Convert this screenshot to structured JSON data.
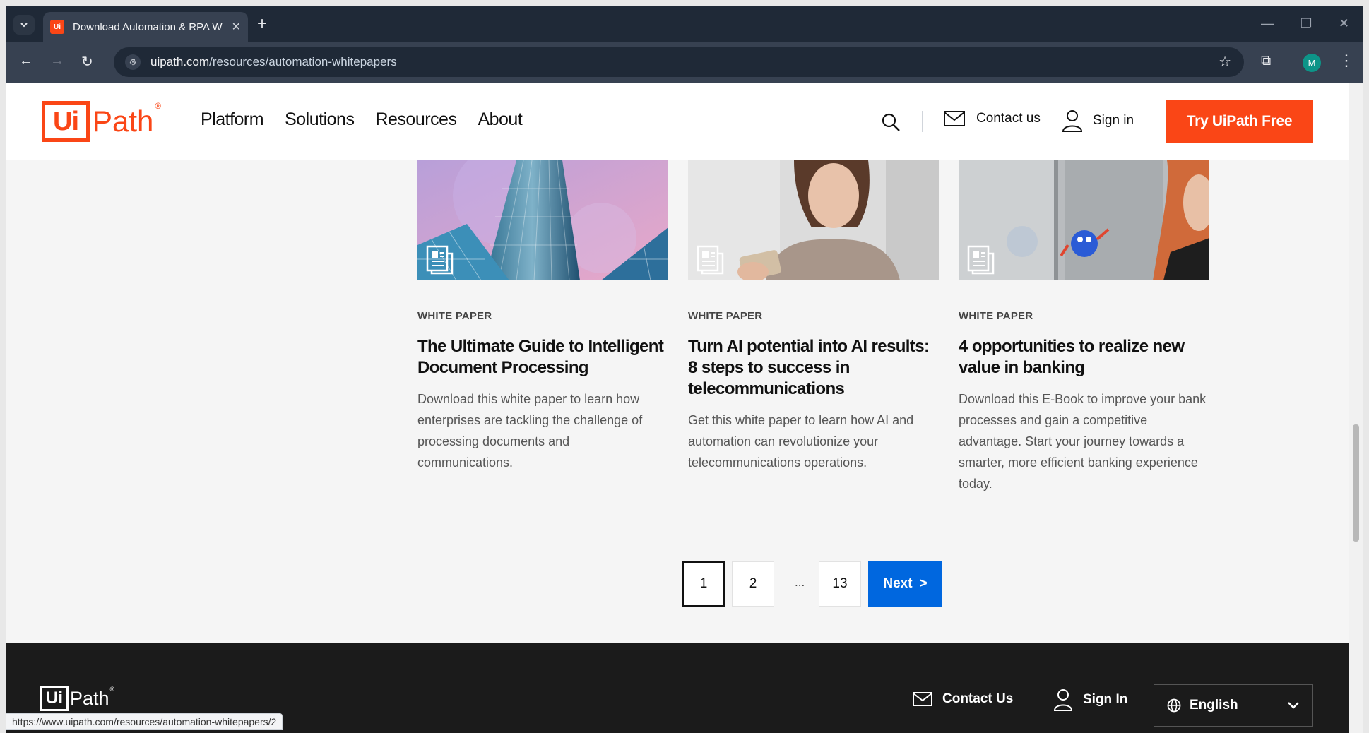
{
  "browser": {
    "tab_title": "Download Automation & RPA W",
    "favicon_label": "Ui",
    "url_domain": "uipath.com",
    "url_path": "/resources/automation-whitepapers",
    "avatar_letter": "M",
    "status_url": "https://www.uipath.com/resources/automation-whitepapers/2"
  },
  "header": {
    "logo_ui": "Ui",
    "logo_path": "Path",
    "logo_reg": "®",
    "nav": [
      "Platform",
      "Solutions",
      "Resources",
      "About"
    ],
    "contact_label": "Contact us",
    "signin_label": "Sign in",
    "cta_label": "Try UiPath Free"
  },
  "cards": [
    {
      "tag": "WHITE PAPER",
      "title": "The Ultimate Guide to Intelligent Document Processing",
      "description": "Download this white paper to learn how enterprises are tackling the challenge of processing documents and communications."
    },
    {
      "tag": "WHITE PAPER",
      "title": "Turn AI potential into AI results: 8 steps to success in telecommunications",
      "description": "Get this white paper to learn how AI and automation can revolutionize your telecommunications operations."
    },
    {
      "tag": "WHITE PAPER",
      "title": "4 opportunities to realize new value in banking",
      "description": "Download this E-Book to improve your bank processes and gain a competitive advantage. Start your journey towards a smarter, more efficient banking experience today."
    }
  ],
  "pagination": {
    "pages": [
      "1",
      "2",
      "13"
    ],
    "ellipsis": "...",
    "current": "1",
    "next_label": "Next",
    "next_glyph": ">"
  },
  "footer": {
    "logo_ui": "Ui",
    "logo_path": "Path",
    "logo_reg": "®",
    "contact_label": "Contact Us",
    "signin_label": "Sign In",
    "language": "English"
  },
  "colors": {
    "brand_orange": "#fa4616",
    "next_blue": "#0067df",
    "footer_bg": "#1b1b1b"
  }
}
